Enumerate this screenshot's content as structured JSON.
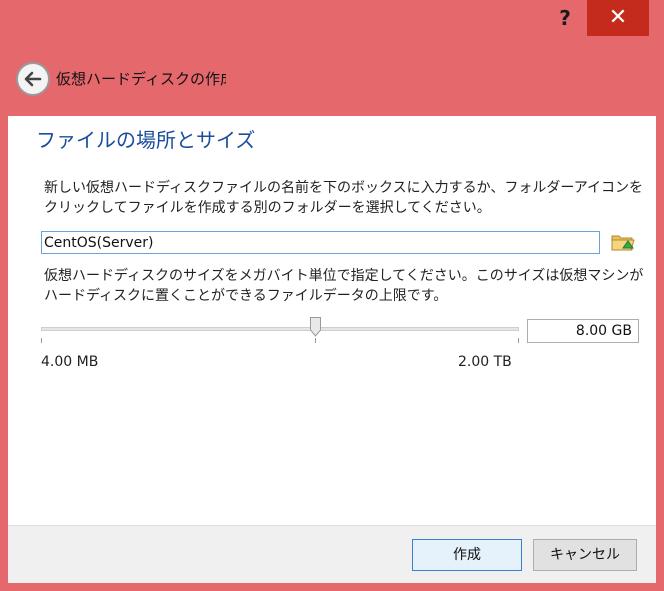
{
  "titlebar": {
    "help_label": "?",
    "close_label": "✕"
  },
  "header": {
    "title": "仮想ハードディスクの作成",
    "back_icon": "back-arrow-icon"
  },
  "section": {
    "title": "ファイルの場所とサイズ"
  },
  "file": {
    "description": "新しい仮想ハードディスクファイルの名前を下のボックスに入力するか、フォルダーアイコンをクリックしてファイルを作成する別のフォルダーを選択してください。",
    "value": "CentOS(Server)",
    "folder_icon": "folder-icon"
  },
  "size": {
    "description": "仮想ハードディスクのサイズをメガバイト単位で指定してください。このサイズは仮想マシンがハードディスクに置くことができるファイルデータの上限です。",
    "value": "8.00 GB",
    "min_label": "4.00 MB",
    "max_label": "2.00 TB"
  },
  "buttons": {
    "create": "作成",
    "cancel": "キャンセル"
  },
  "colors": {
    "frame": "#e5686d",
    "close": "#c42b1c",
    "title_blue": "#1a4d9c",
    "focus_border": "#6aa3d8"
  }
}
